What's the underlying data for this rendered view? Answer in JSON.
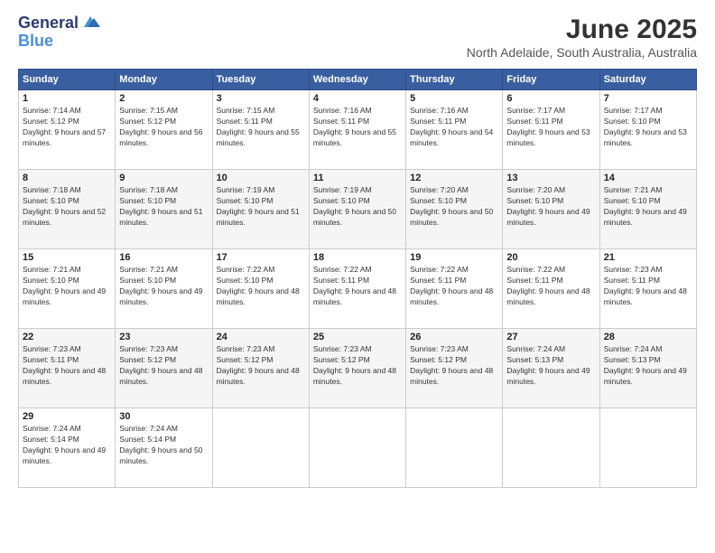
{
  "logo": {
    "line1": "General",
    "line2": "Blue"
  },
  "title": "June 2025",
  "location": "North Adelaide, South Australia, Australia",
  "headers": [
    "Sunday",
    "Monday",
    "Tuesday",
    "Wednesday",
    "Thursday",
    "Friday",
    "Saturday"
  ],
  "weeks": [
    [
      {
        "day": "1",
        "sunrise": "Sunrise: 7:14 AM",
        "sunset": "Sunset: 5:12 PM",
        "daylight": "Daylight: 9 hours and 57 minutes."
      },
      {
        "day": "2",
        "sunrise": "Sunrise: 7:15 AM",
        "sunset": "Sunset: 5:12 PM",
        "daylight": "Daylight: 9 hours and 56 minutes."
      },
      {
        "day": "3",
        "sunrise": "Sunrise: 7:15 AM",
        "sunset": "Sunset: 5:11 PM",
        "daylight": "Daylight: 9 hours and 55 minutes."
      },
      {
        "day": "4",
        "sunrise": "Sunrise: 7:16 AM",
        "sunset": "Sunset: 5:11 PM",
        "daylight": "Daylight: 9 hours and 55 minutes."
      },
      {
        "day": "5",
        "sunrise": "Sunrise: 7:16 AM",
        "sunset": "Sunset: 5:11 PM",
        "daylight": "Daylight: 9 hours and 54 minutes."
      },
      {
        "day": "6",
        "sunrise": "Sunrise: 7:17 AM",
        "sunset": "Sunset: 5:11 PM",
        "daylight": "Daylight: 9 hours and 53 minutes."
      },
      {
        "day": "7",
        "sunrise": "Sunrise: 7:17 AM",
        "sunset": "Sunset: 5:10 PM",
        "daylight": "Daylight: 9 hours and 53 minutes."
      }
    ],
    [
      {
        "day": "8",
        "sunrise": "Sunrise: 7:18 AM",
        "sunset": "Sunset: 5:10 PM",
        "daylight": "Daylight: 9 hours and 52 minutes."
      },
      {
        "day": "9",
        "sunrise": "Sunrise: 7:18 AM",
        "sunset": "Sunset: 5:10 PM",
        "daylight": "Daylight: 9 hours and 51 minutes."
      },
      {
        "day": "10",
        "sunrise": "Sunrise: 7:19 AM",
        "sunset": "Sunset: 5:10 PM",
        "daylight": "Daylight: 9 hours and 51 minutes."
      },
      {
        "day": "11",
        "sunrise": "Sunrise: 7:19 AM",
        "sunset": "Sunset: 5:10 PM",
        "daylight": "Daylight: 9 hours and 50 minutes."
      },
      {
        "day": "12",
        "sunrise": "Sunrise: 7:20 AM",
        "sunset": "Sunset: 5:10 PM",
        "daylight": "Daylight: 9 hours and 50 minutes."
      },
      {
        "day": "13",
        "sunrise": "Sunrise: 7:20 AM",
        "sunset": "Sunset: 5:10 PM",
        "daylight": "Daylight: 9 hours and 49 minutes."
      },
      {
        "day": "14",
        "sunrise": "Sunrise: 7:21 AM",
        "sunset": "Sunset: 5:10 PM",
        "daylight": "Daylight: 9 hours and 49 minutes."
      }
    ],
    [
      {
        "day": "15",
        "sunrise": "Sunrise: 7:21 AM",
        "sunset": "Sunset: 5:10 PM",
        "daylight": "Daylight: 9 hours and 49 minutes."
      },
      {
        "day": "16",
        "sunrise": "Sunrise: 7:21 AM",
        "sunset": "Sunset: 5:10 PM",
        "daylight": "Daylight: 9 hours and 49 minutes."
      },
      {
        "day": "17",
        "sunrise": "Sunrise: 7:22 AM",
        "sunset": "Sunset: 5:10 PM",
        "daylight": "Daylight: 9 hours and 48 minutes."
      },
      {
        "day": "18",
        "sunrise": "Sunrise: 7:22 AM",
        "sunset": "Sunset: 5:11 PM",
        "daylight": "Daylight: 9 hours and 48 minutes."
      },
      {
        "day": "19",
        "sunrise": "Sunrise: 7:22 AM",
        "sunset": "Sunset: 5:11 PM",
        "daylight": "Daylight: 9 hours and 48 minutes."
      },
      {
        "day": "20",
        "sunrise": "Sunrise: 7:22 AM",
        "sunset": "Sunset: 5:11 PM",
        "daylight": "Daylight: 9 hours and 48 minutes."
      },
      {
        "day": "21",
        "sunrise": "Sunrise: 7:23 AM",
        "sunset": "Sunset: 5:11 PM",
        "daylight": "Daylight: 9 hours and 48 minutes."
      }
    ],
    [
      {
        "day": "22",
        "sunrise": "Sunrise: 7:23 AM",
        "sunset": "Sunset: 5:11 PM",
        "daylight": "Daylight: 9 hours and 48 minutes."
      },
      {
        "day": "23",
        "sunrise": "Sunrise: 7:23 AM",
        "sunset": "Sunset: 5:12 PM",
        "daylight": "Daylight: 9 hours and 48 minutes."
      },
      {
        "day": "24",
        "sunrise": "Sunrise: 7:23 AM",
        "sunset": "Sunset: 5:12 PM",
        "daylight": "Daylight: 9 hours and 48 minutes."
      },
      {
        "day": "25",
        "sunrise": "Sunrise: 7:23 AM",
        "sunset": "Sunset: 5:12 PM",
        "daylight": "Daylight: 9 hours and 48 minutes."
      },
      {
        "day": "26",
        "sunrise": "Sunrise: 7:23 AM",
        "sunset": "Sunset: 5:12 PM",
        "daylight": "Daylight: 9 hours and 48 minutes."
      },
      {
        "day": "27",
        "sunrise": "Sunrise: 7:24 AM",
        "sunset": "Sunset: 5:13 PM",
        "daylight": "Daylight: 9 hours and 49 minutes."
      },
      {
        "day": "28",
        "sunrise": "Sunrise: 7:24 AM",
        "sunset": "Sunset: 5:13 PM",
        "daylight": "Daylight: 9 hours and 49 minutes."
      }
    ],
    [
      {
        "day": "29",
        "sunrise": "Sunrise: 7:24 AM",
        "sunset": "Sunset: 5:14 PM",
        "daylight": "Daylight: 9 hours and 49 minutes."
      },
      {
        "day": "30",
        "sunrise": "Sunrise: 7:24 AM",
        "sunset": "Sunset: 5:14 PM",
        "daylight": "Daylight: 9 hours and 50 minutes."
      },
      null,
      null,
      null,
      null,
      null
    ]
  ],
  "colors": {
    "header_bg": "#3a5fa0",
    "header_text": "#ffffff",
    "row_even": "#f5f5f5",
    "row_odd": "#ffffff"
  }
}
